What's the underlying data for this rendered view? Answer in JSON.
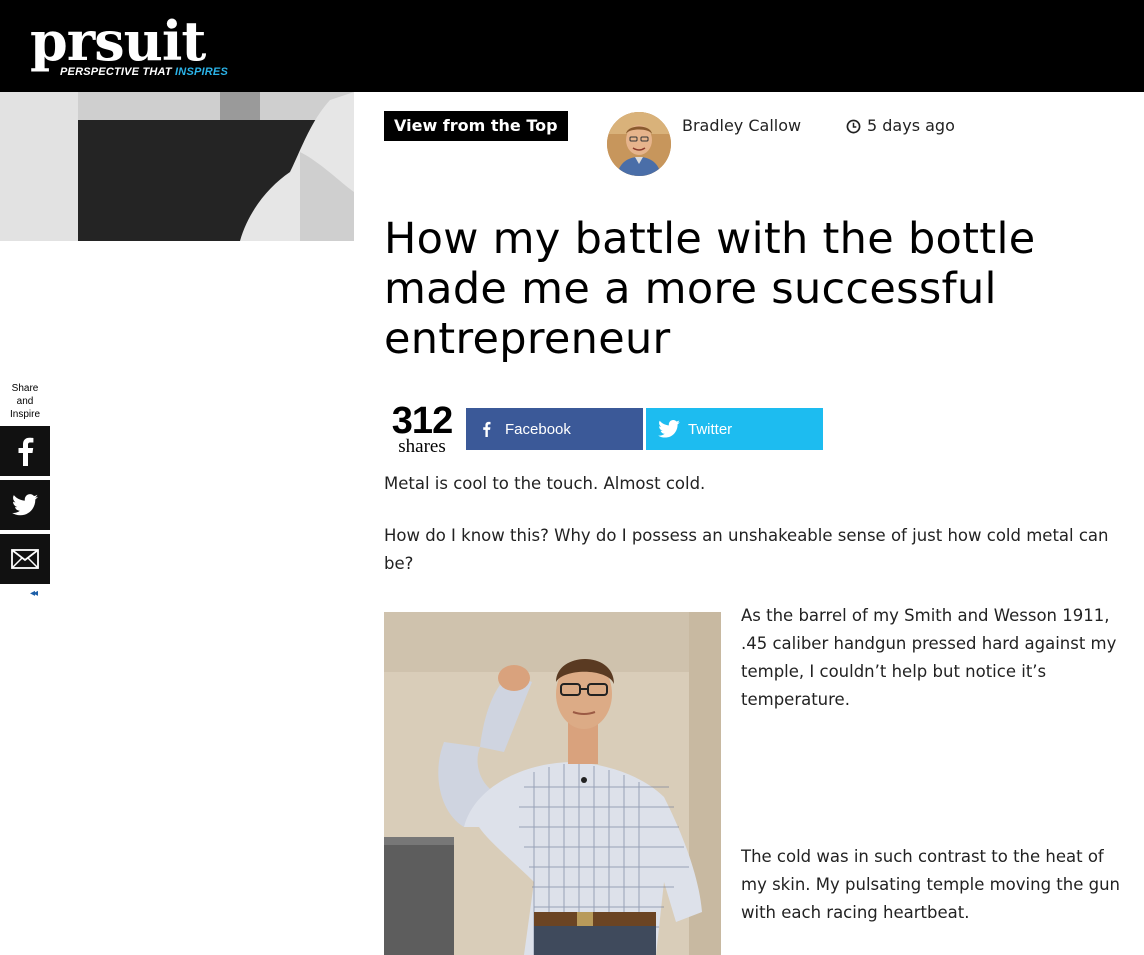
{
  "brand": {
    "name": "prsuit",
    "tagline_prefix": "PERSPECTIVE THAT ",
    "tagline_accent": "INSPIRES",
    "accent_color": "#2bb3e8"
  },
  "share_sidebar": {
    "label_lines": [
      "Share",
      "and",
      "Inspire"
    ],
    "buttons": [
      {
        "icon": "facebook-icon"
      },
      {
        "icon": "twitter-icon"
      },
      {
        "icon": "email-icon"
      }
    ],
    "collapse_glyph": "◂◂"
  },
  "article": {
    "category": "View from the Top",
    "author": "Bradley Callow",
    "time_ago": "5 days ago",
    "title": "How my battle with the bottle made me a more successful entrepreneur",
    "share_count": "312",
    "share_count_label": "shares",
    "facebook_label": "Facebook",
    "twitter_label": "Twitter",
    "facebook_color": "#3b5998",
    "twitter_color": "#1dbcf0",
    "paragraphs": [
      "Metal is cool to the touch. Almost cold.",
      "How do I know this? Why do I possess an unshakeable sense of just how cold metal can be?",
      "As the barrel of my Smith and Wesson 1911, .45 caliber handgun pressed hard against my temple, I couldn’t help but notice it’s temperature.",
      "The cold was in such contrast to the heat of my skin. My pulsating temple moving the gun with each racing heartbeat."
    ]
  }
}
